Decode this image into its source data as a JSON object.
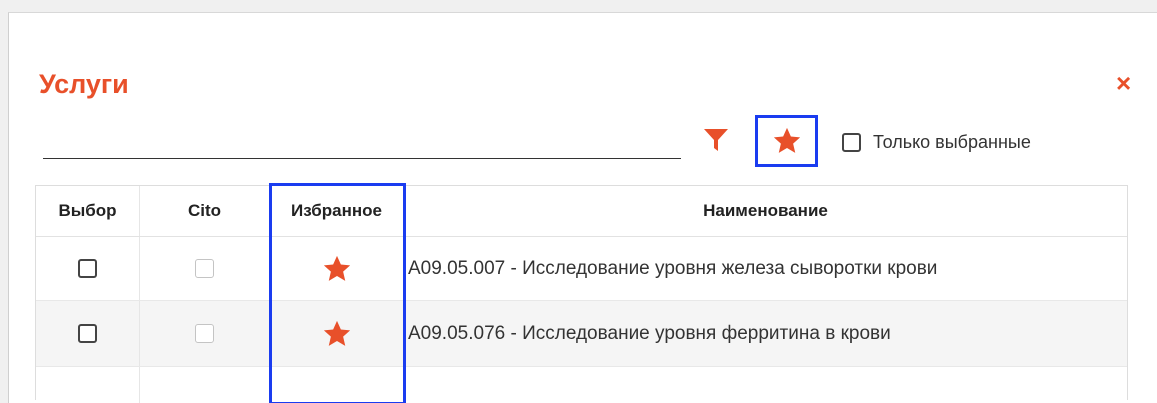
{
  "dialog": {
    "title": "Услуги",
    "close_label": "×"
  },
  "toolbar": {
    "search": {
      "value": "",
      "placeholder": ""
    },
    "only_selected_label": "Только выбранные",
    "only_selected_checked": false,
    "accent_color": "#e8502a",
    "highlight_color": "#1a3cf0"
  },
  "table": {
    "columns": [
      "Выбор",
      "Cito",
      "Избранное",
      "Наименование"
    ],
    "rows": [
      {
        "select": false,
        "cito": false,
        "favorite": true,
        "name": "A09.05.007 - Исследование уровня железа сыворотки крови"
      },
      {
        "select": false,
        "cito": false,
        "favorite": true,
        "name": "A09.05.076 - Исследование уровня ферритина в крови"
      }
    ]
  },
  "icons": [
    "filter-icon",
    "star-icon",
    "close-icon"
  ]
}
